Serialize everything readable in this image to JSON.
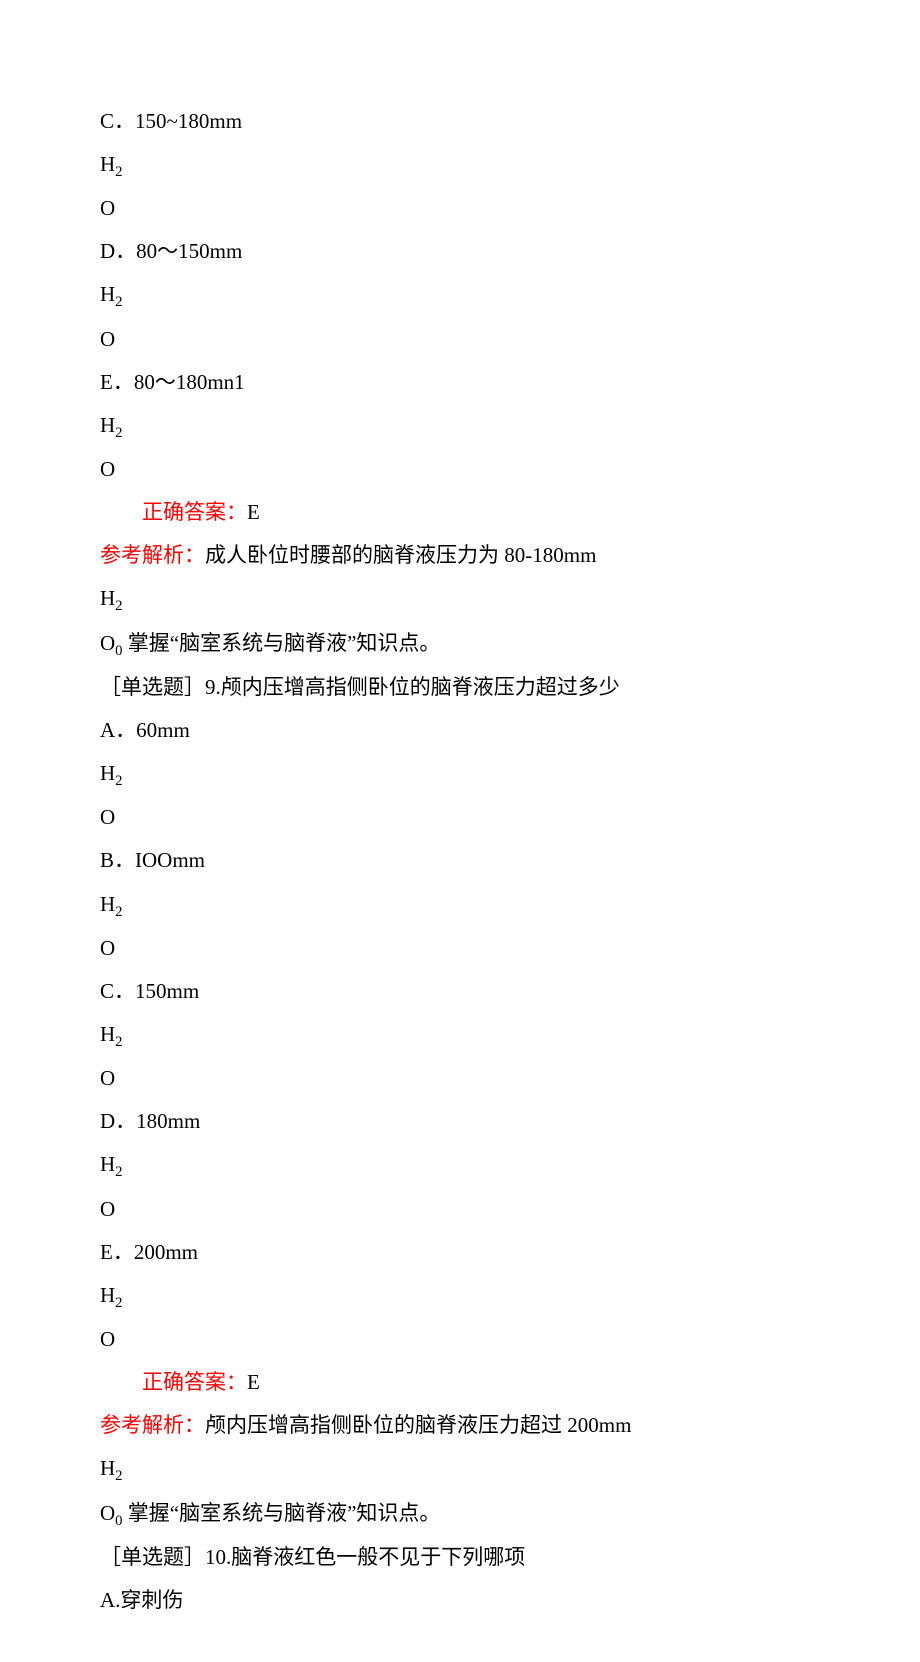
{
  "lines": [
    {
      "type": "plain",
      "text": "C．150~180mm"
    },
    {
      "type": "h2",
      "text": "H"
    },
    {
      "type": "plain",
      "text": "O"
    },
    {
      "type": "plain",
      "text": "D．80～150mm"
    },
    {
      "type": "h2",
      "text": "H"
    },
    {
      "type": "plain",
      "text": "O"
    },
    {
      "type": "plain",
      "text": "E．80～180mn1"
    },
    {
      "type": "h2",
      "text": "H"
    },
    {
      "type": "plain",
      "text": "O"
    },
    {
      "type": "answer",
      "label": "正确答案：",
      "value": "E"
    },
    {
      "type": "analysis",
      "label": "参考解析：",
      "value": "成人卧位时腰部的脑脊液压力为 80-180mm"
    },
    {
      "type": "h2",
      "text": "H"
    },
    {
      "type": "o0",
      "prefix": "O",
      "sub": "0",
      "rest": " 掌握“脑室系统与脑脊液”知识点。"
    },
    {
      "type": "plain",
      "text": "［单选题］9.颅内压增高指侧卧位的脑脊液压力超过多少"
    },
    {
      "type": "plain",
      "text": "A．60mm"
    },
    {
      "type": "h2",
      "text": "H"
    },
    {
      "type": "plain",
      "text": "O"
    },
    {
      "type": "plain",
      "text": "B．IOOmm"
    },
    {
      "type": "h2",
      "text": "H"
    },
    {
      "type": "plain",
      "text": "O"
    },
    {
      "type": "plain",
      "text": "C．150mm"
    },
    {
      "type": "h2",
      "text": "H"
    },
    {
      "type": "plain",
      "text": "O"
    },
    {
      "type": "plain",
      "text": "D．180mm"
    },
    {
      "type": "h2",
      "text": "H"
    },
    {
      "type": "plain",
      "text": "O"
    },
    {
      "type": "plain",
      "text": "E．200mm"
    },
    {
      "type": "h2",
      "text": "H"
    },
    {
      "type": "plain",
      "text": "O"
    },
    {
      "type": "answer",
      "label": "正确答案：",
      "value": "E"
    },
    {
      "type": "analysis",
      "label": "参考解析：",
      "value": "颅内压增高指侧卧位的脑脊液压力超过 200mm"
    },
    {
      "type": "h2",
      "text": "H"
    },
    {
      "type": "o0",
      "prefix": "O",
      "sub": "0",
      "rest": " 掌握“脑室系统与脑脊液”知识点。"
    },
    {
      "type": "plain",
      "text": "［单选题］10.脑脊液红色一般不见于下列哪项"
    },
    {
      "type": "plain",
      "text": "A.穿刺伤"
    }
  ]
}
